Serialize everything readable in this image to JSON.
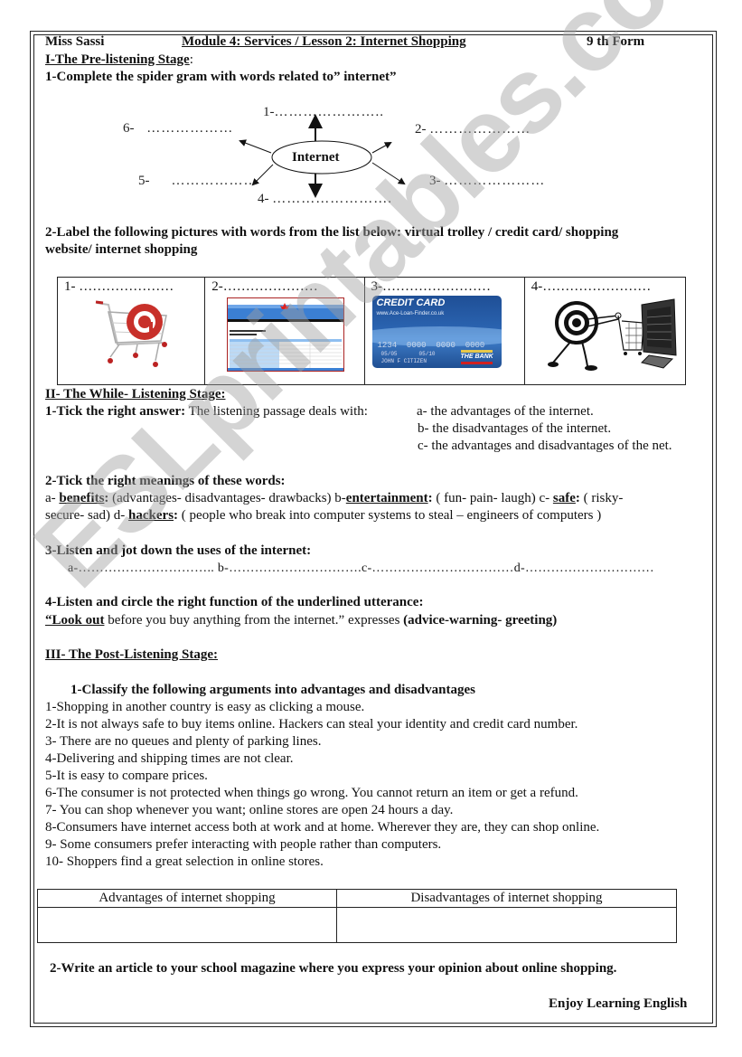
{
  "header": {
    "teacher": "Miss Sassi",
    "module": "Module 4: Services / Lesson 2: Internet Shopping",
    "form": "9 th Form"
  },
  "section1": {
    "title": "I-The Pre-listening Stage",
    "title_colon": ":",
    "task1": {
      "instruction": "1-Complete the spider gram with words related to” internet”",
      "center": "Internet",
      "branches": [
        {
          "num": "1-",
          "blank": "………………….."
        },
        {
          "num": "2-",
          "blank": "…………………"
        },
        {
          "num": "3-",
          "blank": "…………………"
        },
        {
          "num": "4-",
          "blank": "……………………."
        },
        {
          "num": "5-",
          "blank": "………………"
        },
        {
          "num": "6-",
          "blank": "………………"
        }
      ]
    },
    "task2": {
      "instruction_bold": "2-Label the following pictures with words from the list below:",
      "word_list_line1": " virtual trolley / credit card/ shopping",
      "word_list_line2": "website/ internet shopping",
      "pictures": [
        {
          "num": "1-",
          "blank": " …………………",
          "image": "shopping-cart-with-at-sign"
        },
        {
          "num": "2-",
          "blank": "…………………",
          "image": "shopping-website-screenshot"
        },
        {
          "num": "3-",
          "blank": "……………………",
          "image": "credit-card",
          "card": {
            "title": "CREDIT CARD",
            "url": "www.Ace-Loan-Finder.co.uk",
            "number": "1234  0000  0000  0000",
            "valid_from": "05/05",
            "expires": "05/10",
            "holder": "JOHN F CITIZEN",
            "bank": "THE BANK"
          }
        },
        {
          "num": "4-",
          "blank": "……………………",
          "image": "at-sign-pushing-cart-into-computer"
        }
      ]
    }
  },
  "section2": {
    "title": "II- The While- Listening Stage:",
    "task1": {
      "label": "1-Tick the right answer:",
      "prompt": " The listening passage deals with:",
      "options": [
        "a- the advantages of the internet.",
        "b- the disadvantages of the internet.",
        "c- the advantages and disadvantages of the net."
      ]
    },
    "task2": {
      "label": "2-Tick the right meanings of these words:",
      "a_prefix": "a- ",
      "a_word": "benefits",
      "a_colon": ":",
      "a_options": " (advantages- disadvantages- drawbacks)  b-",
      "b_word": "entertainment",
      "b_colon": ":",
      "b_options": " ( fun- pain- laugh) c- ",
      "c_word": "safe",
      "c_colon": ":",
      "c_options": " ( risky-",
      "line2_prefix": "secure- sad) d- ",
      "d_word": "hackers",
      "d_colon": ":",
      "d_options": " ( people who break into computer systems to steal – engineers of computers )"
    },
    "task3": {
      "label": "3-Listen and jot down the uses of the internet:",
      "blanks": "a-………………………….. b-………………………….c-……………………………d-…………………………"
    },
    "task4": {
      "label": "4-Listen and circle the right function of the underlined utterance:",
      "quote_underlined": "“Look out",
      "quote_rest": " before you buy anything from the internet.” expresses ",
      "choices": "(advice-warning- greeting)"
    }
  },
  "section3": {
    "title": "III- The Post-Listening Stage:",
    "task1": {
      "label": "1-Classify the following arguments into advantages and disadvantages",
      "arguments": [
        "1-Shopping in another country is easy as clicking a mouse.",
        "2-It is not always safe to buy items online. Hackers can steal your identity and credit card number.",
        "3- There are no queues and plenty of parking lines.",
        "4-Delivering and shipping times are not clear.",
        "5-It is easy to compare prices.",
        "6-The consumer is not protected when things go wrong.  You cannot return an item or get a refund.",
        "7- You can shop whenever you want; online stores are open 24 hours a day.",
        "8-Consumers have internet access both at work and at home. Wherever they are, they can shop online.",
        "9- Some consumers prefer interacting with people rather than computers.",
        "10- Shoppers find a great selection in online stores."
      ],
      "table_headers": [
        "Advantages of internet shopping",
        "Disadvantages of internet shopping"
      ]
    },
    "task2": {
      "label": "2-Write an article to your school magazine where you express your opinion about online shopping."
    }
  },
  "footer": {
    "signoff": "Enjoy Learning English"
  },
  "watermark": "ESLprintables.com"
}
